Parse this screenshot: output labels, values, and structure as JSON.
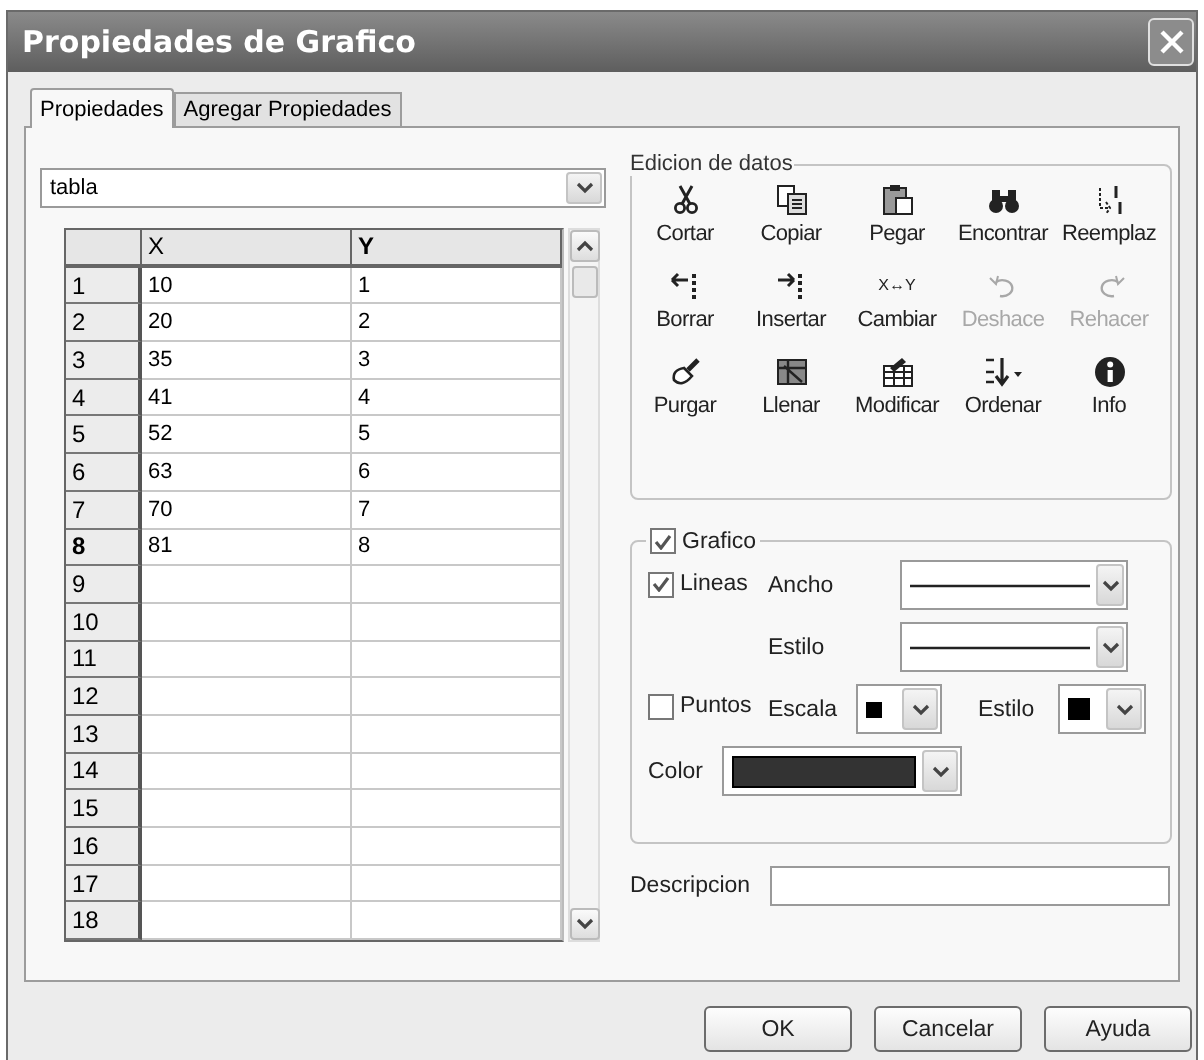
{
  "window": {
    "title": "Propiedades de Grafico"
  },
  "tabs": [
    {
      "label": "Propiedades",
      "selected": true
    },
    {
      "label": "Agregar Propiedades",
      "selected": false
    }
  ],
  "table_selector": {
    "value": "tabla"
  },
  "table": {
    "columns": [
      "X",
      "Y"
    ],
    "rows": [
      {
        "number": "1",
        "cells": [
          "10",
          "1"
        ],
        "selected": false
      },
      {
        "number": "2",
        "cells": [
          "20",
          "2"
        ],
        "selected": false
      },
      {
        "number": "3",
        "cells": [
          "35",
          "3"
        ],
        "selected": false
      },
      {
        "number": "4",
        "cells": [
          "41",
          "4"
        ],
        "selected": false
      },
      {
        "number": "5",
        "cells": [
          "52",
          "5"
        ],
        "selected": false
      },
      {
        "number": "6",
        "cells": [
          "63",
          "6"
        ],
        "selected": false
      },
      {
        "number": "7",
        "cells": [
          "70",
          "7"
        ],
        "selected": false
      },
      {
        "number": "8",
        "cells": [
          "81",
          "8"
        ],
        "selected": true
      },
      {
        "number": "9",
        "selected": false
      },
      {
        "number": "10",
        "selected": false
      },
      {
        "number": "11",
        "selected": false
      },
      {
        "number": "12",
        "selected": false
      },
      {
        "number": "13",
        "selected": false
      },
      {
        "number": "14",
        "selected": false
      },
      {
        "number": "15",
        "selected": false
      },
      {
        "number": "16",
        "selected": false
      },
      {
        "number": "17",
        "selected": false
      },
      {
        "number": "18",
        "selected": false
      }
    ]
  },
  "data_editing": {
    "title": "Edicion de datos",
    "tools": [
      {
        "label": "Cortar",
        "disabled": false
      },
      {
        "label": "Copiar",
        "disabled": false
      },
      {
        "label": "Pegar",
        "disabled": false
      },
      {
        "label": "Encontrar",
        "disabled": false
      },
      {
        "label": "Reemplaz",
        "disabled": false
      },
      {
        "label": "Borrar",
        "disabled": false
      },
      {
        "label": "Insertar",
        "disabled": false
      },
      {
        "label": "Cambiar",
        "disabled": false,
        "glyph": "X↔Y"
      },
      {
        "label": "Deshace",
        "disabled": true
      },
      {
        "label": "Rehacer",
        "disabled": true
      },
      {
        "label": "Purgar",
        "disabled": false
      },
      {
        "label": "Llenar",
        "disabled": false
      },
      {
        "label": "Modificar",
        "disabled": false
      },
      {
        "label": "Ordenar",
        "disabled": false
      },
      {
        "label": "Info",
        "disabled": false
      }
    ]
  },
  "graph": {
    "label": "Grafico",
    "checked": true,
    "lines": {
      "label": "Lineas",
      "checked": true
    },
    "width_label": "Ancho",
    "line_style_label": "Estilo",
    "points": {
      "label": "Puntos",
      "checked": false
    },
    "scale_label": "Escala",
    "point_style_label": "Estilo",
    "color_label": "Color",
    "color": "#333333"
  },
  "description": {
    "label": "Descripcion"
  },
  "buttons": [
    "OK",
    "Cancelar",
    "Ayuda"
  ]
}
